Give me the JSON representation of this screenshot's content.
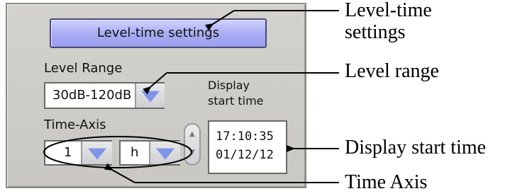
{
  "panel": {
    "header_button": "Level-time settings",
    "level_range": {
      "label": "Level Range",
      "value": "30dB-120dB"
    },
    "display_start_label": [
      "Display",
      "start time"
    ],
    "time_axis": {
      "label": "Time-Axis",
      "amount": "1",
      "unit": "h"
    },
    "start_time": {
      "time": "17:10:35",
      "date": "01/12/12"
    }
  },
  "annotations": {
    "level_time_settings": [
      "Level-time",
      "settings"
    ],
    "level_range": "Level range",
    "display_start_time": "Display start time",
    "time_axis": "Time Axis"
  },
  "colors": {
    "button_fill": "#a8abf2",
    "dropdown_arrow": "#7f95e6",
    "panel_bg": "#d4d2cc"
  },
  "icons": {
    "dropdown": "chevron-down-icon",
    "spinner": "up-down-spinner-icon"
  }
}
